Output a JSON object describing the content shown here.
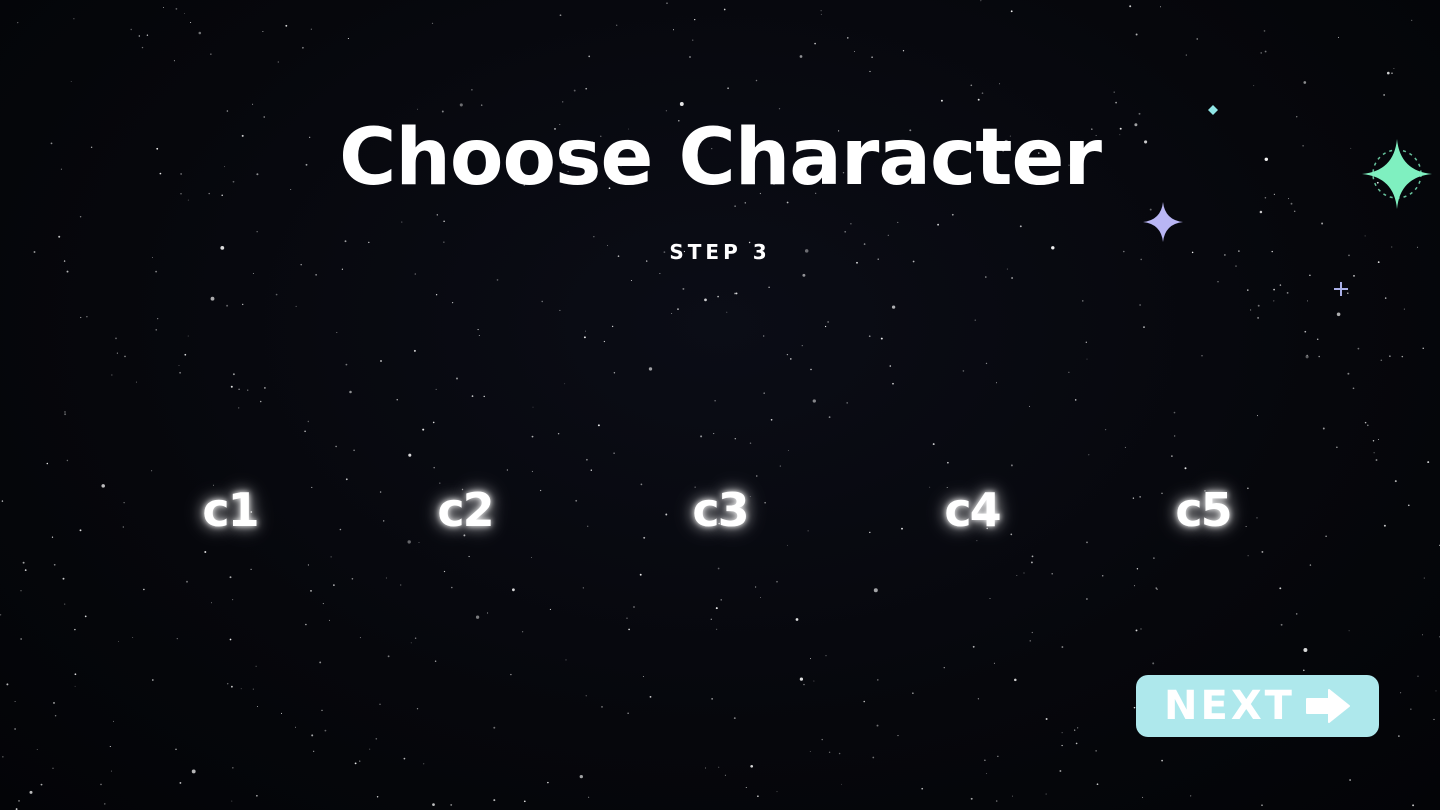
{
  "screen": {
    "title": "Choose Character",
    "step_label": "STEP 3"
  },
  "characters": [
    {
      "label": "c1"
    },
    {
      "label": "c2"
    },
    {
      "label": "c3"
    },
    {
      "label": "c4"
    },
    {
      "label": "c5"
    }
  ],
  "next_button": {
    "label": "NEXT",
    "icon": "arrow-right-icon",
    "color": "#aee8ec"
  },
  "decorations": {
    "sparkle_colors": [
      "#7ff0c0",
      "#b9b6f4",
      "#a9b0e8",
      "#8fe6e6"
    ]
  }
}
